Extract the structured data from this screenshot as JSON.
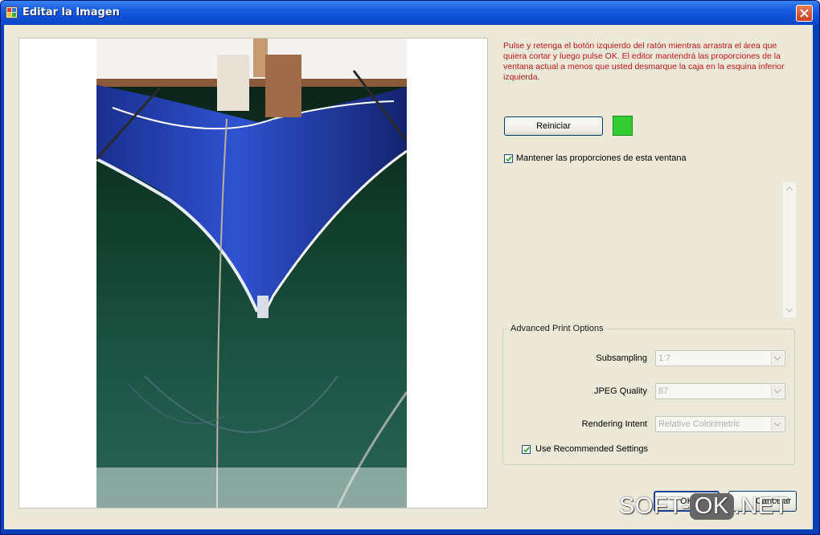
{
  "window": {
    "title": "Editar la Imagen",
    "icon": "app-image-icon",
    "close_icon": "close-icon"
  },
  "instructions": "Pulse y retenga el botón izquierdo del ratón mientras arrastra el área que quiera cortar y luego pulse OK. El editor mantendrá las proporciones de la ventana actual a menos que usted desmarque la caja en la esquina inferior izquierda.",
  "reset_button": "Reiniciar",
  "color_swatch": "#33cc33",
  "keep_proportions": {
    "label": "Mantener las proporciones de esta ventana",
    "checked": true
  },
  "advanced": {
    "title": "Advanced Print Options",
    "fields": [
      {
        "label": "Subsampling",
        "value": "1:7"
      },
      {
        "label": "JPEG Quality",
        "value": "87"
      },
      {
        "label": "Rendering Intent",
        "value": "Relative Colorimetric"
      }
    ],
    "use_recommended": {
      "label": "Use Recommended Settings",
      "checked": true
    }
  },
  "buttons": {
    "ok": "OK",
    "cancel": "Cancelar"
  },
  "watermark": {
    "left": "SOFT-",
    "middle": "OK",
    "right": ".NET"
  }
}
